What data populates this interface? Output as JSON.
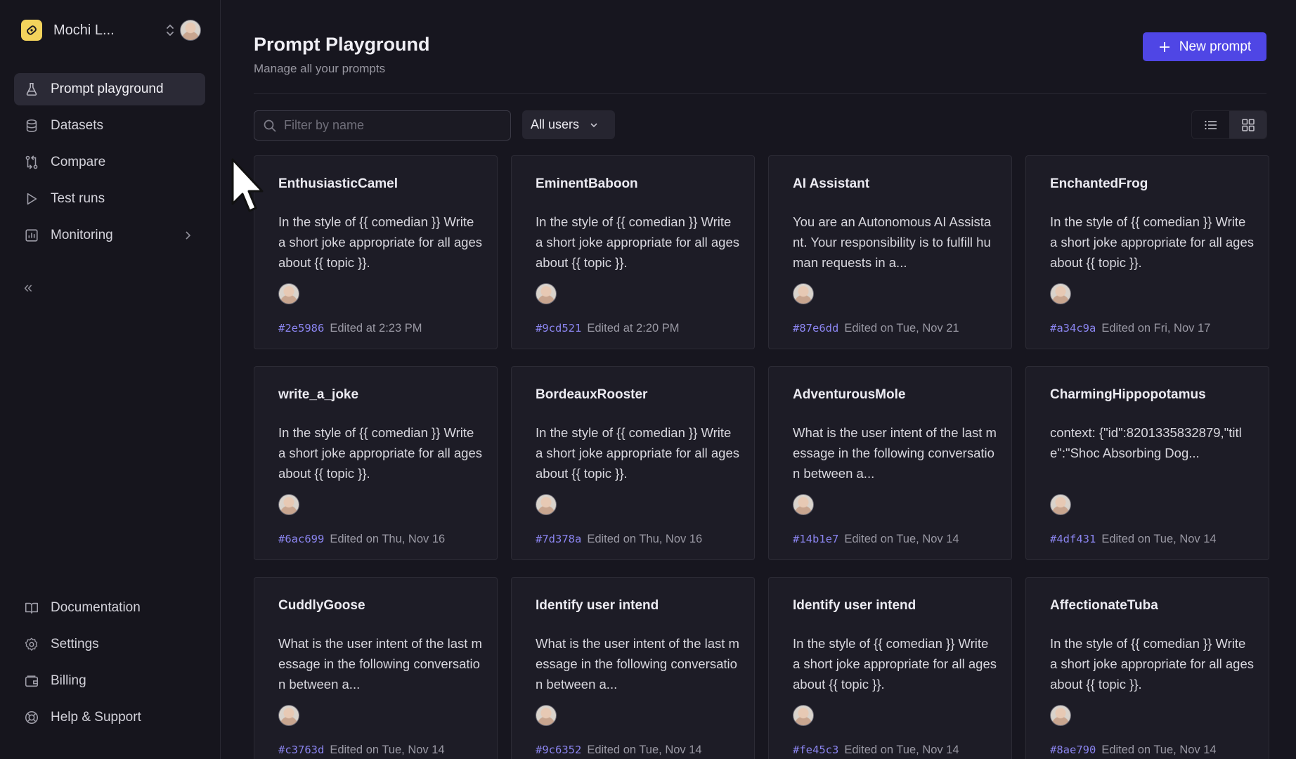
{
  "workspace": {
    "name": "Mochi L...",
    "logo_color": "#f3d35c"
  },
  "sidebar": {
    "items": [
      {
        "label": "Prompt playground",
        "icon": "flask-icon",
        "active": true
      },
      {
        "label": "Datasets",
        "icon": "database-icon"
      },
      {
        "label": "Compare",
        "icon": "compare-icon"
      },
      {
        "label": "Test runs",
        "icon": "play-icon"
      },
      {
        "label": "Monitoring",
        "icon": "chart-icon",
        "has_children": true
      }
    ],
    "collapse_label": "«",
    "bottom_items": [
      {
        "label": "Documentation",
        "icon": "book-icon"
      },
      {
        "label": "Settings",
        "icon": "gear-icon"
      },
      {
        "label": "Billing",
        "icon": "wallet-icon"
      },
      {
        "label": "Help & Support",
        "icon": "lifebuoy-icon"
      }
    ]
  },
  "header": {
    "title": "Prompt Playground",
    "subtitle": "Manage all your prompts",
    "new_button": "New prompt",
    "accent_color": "#4f46e5"
  },
  "filters": {
    "search_placeholder": "Filter by name",
    "users_select": "All users",
    "view_mode": "grid"
  },
  "cards": [
    {
      "title": "EnthusiasticCamel",
      "body": "In the style of {{ comedian }} Write a short joke appropriate for all ages about {{ topic }}.",
      "hash": "#2e5986",
      "edited": "Edited at 2:23 PM"
    },
    {
      "title": "EminentBaboon",
      "body": "In the style of {{ comedian }} Write a short joke appropriate for all ages about {{ topic }}.",
      "hash": "#9cd521",
      "edited": "Edited at 2:20 PM"
    },
    {
      "title": "AI Assistant",
      "body": "You are an Autonomous AI Assistant. Your responsibility is to fulfill human requests in a...",
      "hash": "#87e6dd",
      "edited": "Edited on Tue, Nov 21"
    },
    {
      "title": "EnchantedFrog",
      "body": "In the style of {{ comedian }} Write a short joke appropriate for all ages about {{ topic }}.",
      "hash": "#a34c9a",
      "edited": "Edited on Fri, Nov 17"
    },
    {
      "title": "write_a_joke",
      "body": "In the style of {{ comedian }} Write a short joke appropriate for all ages about {{ topic }}.",
      "hash": "#6ac699",
      "edited": "Edited on Thu, Nov 16"
    },
    {
      "title": "BordeauxRooster",
      "body": "In the style of {{ comedian }} Write a short joke appropriate for all ages about {{ topic }}.",
      "hash": "#7d378a",
      "edited": "Edited on Thu, Nov 16"
    },
    {
      "title": "AdventurousMole",
      "body": "What is the user intent of the last message in the following conversation between a...",
      "hash": "#14b1e7",
      "edited": "Edited on Tue, Nov 14"
    },
    {
      "title": "CharmingHippopotamus",
      "body": "context: {\"id\":8201335832879,\"title\":\"Shoc Absorbing Dog...",
      "hash": "#4df431",
      "edited": "Edited on Tue, Nov 14"
    },
    {
      "title": "CuddlyGoose",
      "body": "What is the user intent of the last message in the following conversation between a...",
      "hash": "#c3763d",
      "edited": "Edited on Tue, Nov 14"
    },
    {
      "title": "Identify user intend",
      "body": "What is the user intent of the last message in the following conversation between a...",
      "hash": "#9c6352",
      "edited": "Edited on Tue, Nov 14"
    },
    {
      "title": "Identify user intend",
      "body": "In the style of {{ comedian }} Write a short joke appropriate for all ages about {{ topic }}.",
      "hash": "#fe45c3",
      "edited": "Edited on Tue, Nov 14"
    },
    {
      "title": "AffectionateTuba",
      "body": "In the style of {{ comedian }} Write a short joke appropriate for all ages about {{ topic }}.",
      "hash": "#8ae790",
      "edited": "Edited on Tue, Nov 14"
    }
  ]
}
